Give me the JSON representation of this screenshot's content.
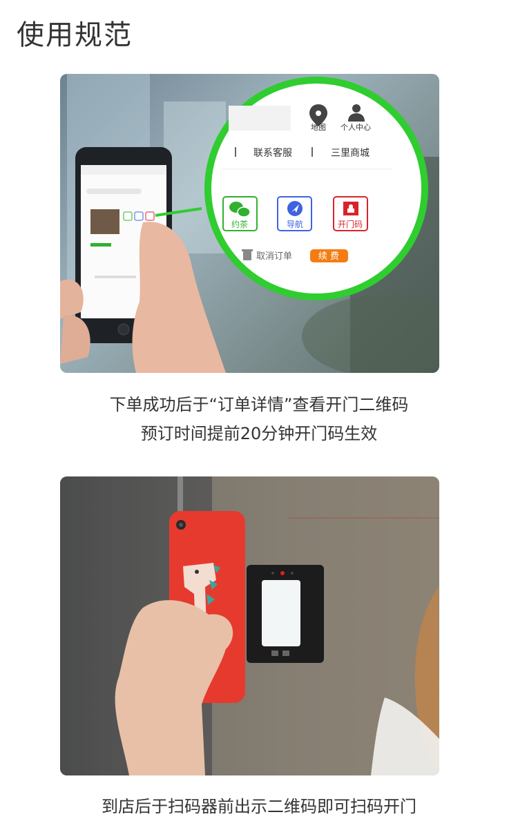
{
  "page": {
    "title": "使用规范"
  },
  "step1": {
    "caption_line1": "下单成功后于“订单详情”查看开门二维码",
    "caption_line2": "预订时间提前20分钟开门码生效",
    "zoom": {
      "map_label": "地图",
      "profile_label": "个人中心",
      "contact_label": "联系客服",
      "mall_label": "三里商城",
      "tea_label": "约茶",
      "nav_label": "导航",
      "door_code_label": "开门码",
      "cancel_label": "取消订单",
      "renew_label": "续 费"
    },
    "colors": {
      "highlight_ring": "#2fcd2f",
      "tea": "#2fb12f",
      "nav": "#3d63e0",
      "door": "#d9232b",
      "renew": "#f47c12"
    }
  },
  "step2": {
    "caption": "到店后于扫码器前出示二维码即可扫码开门",
    "colors": {
      "phone_case": "#e63a2f",
      "scanner": "#1c1c1c"
    }
  }
}
